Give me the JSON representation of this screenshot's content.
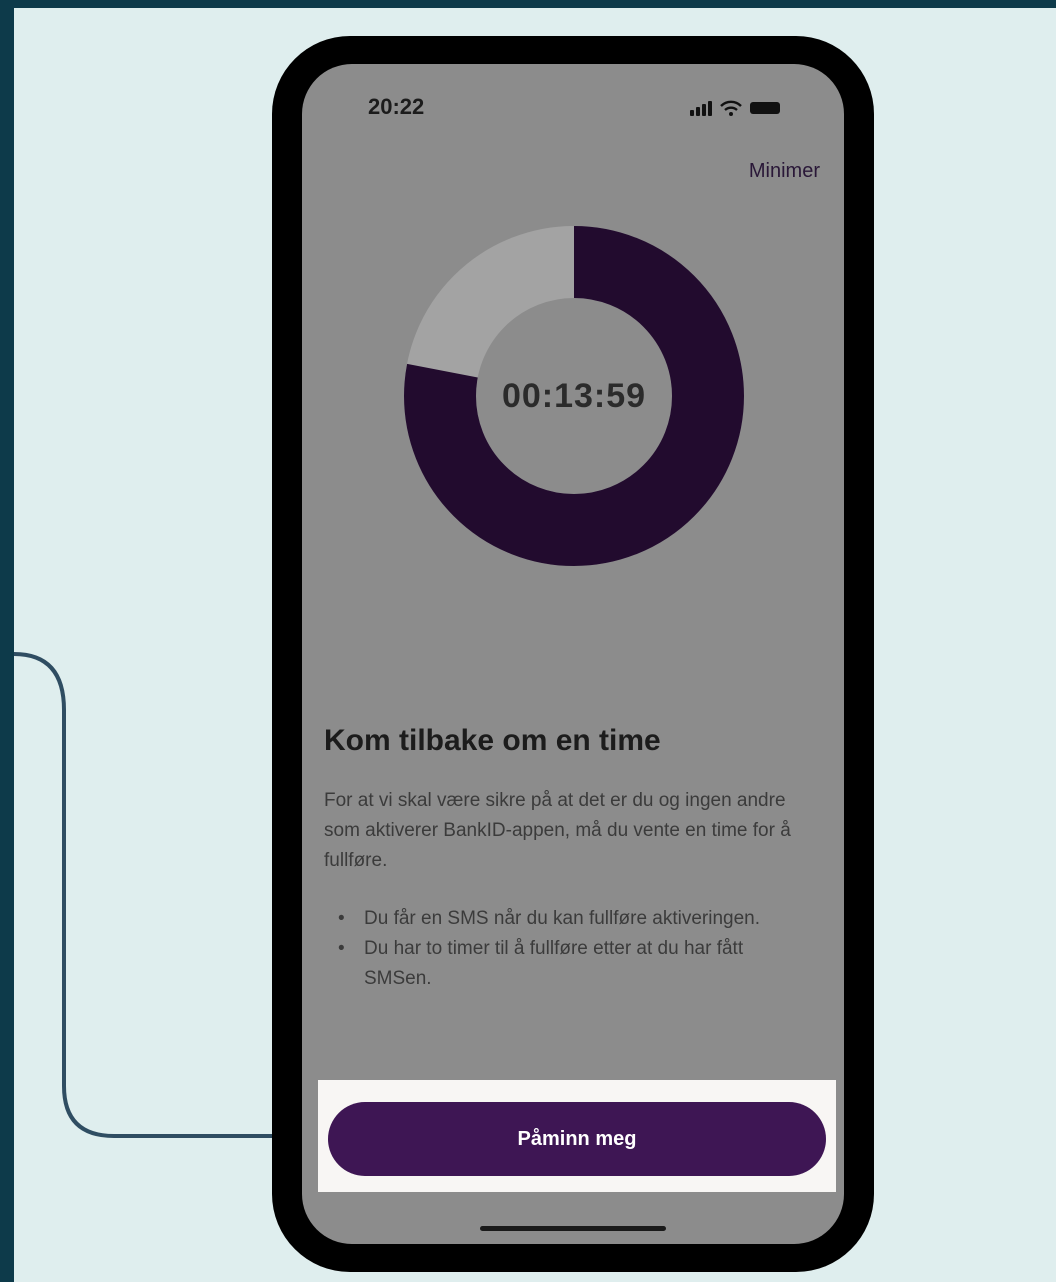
{
  "status_bar": {
    "time": "20:22",
    "icons": [
      "signal-icon",
      "wifi-icon",
      "battery-icon"
    ]
  },
  "header": {
    "minimize_label": "Minimer"
  },
  "timer": {
    "display": "00:13:59",
    "progress_remaining_fraction": 0.78
  },
  "content": {
    "heading": "Kom tilbake om en time",
    "paragraph": "For at vi skal være sikre på at det er du og ingen andre som aktiverer BankID-appen, må du vente en time for å fullføre.",
    "bullets": [
      "Du får en SMS når du kan fullføre aktiveringen.",
      "Du har to timer til å fullføre etter at du har fått SMSen."
    ]
  },
  "cta": {
    "label": "Påminn meg"
  },
  "colors": {
    "background_outer": "#0d3a4a",
    "canvas": "#dfeeee",
    "screen_overlay": "#8c8c8c",
    "ring_progress": "#220b2e",
    "ring_track": "#a3a3a3",
    "button": "#3e1654",
    "connector": "#2f4d62"
  }
}
